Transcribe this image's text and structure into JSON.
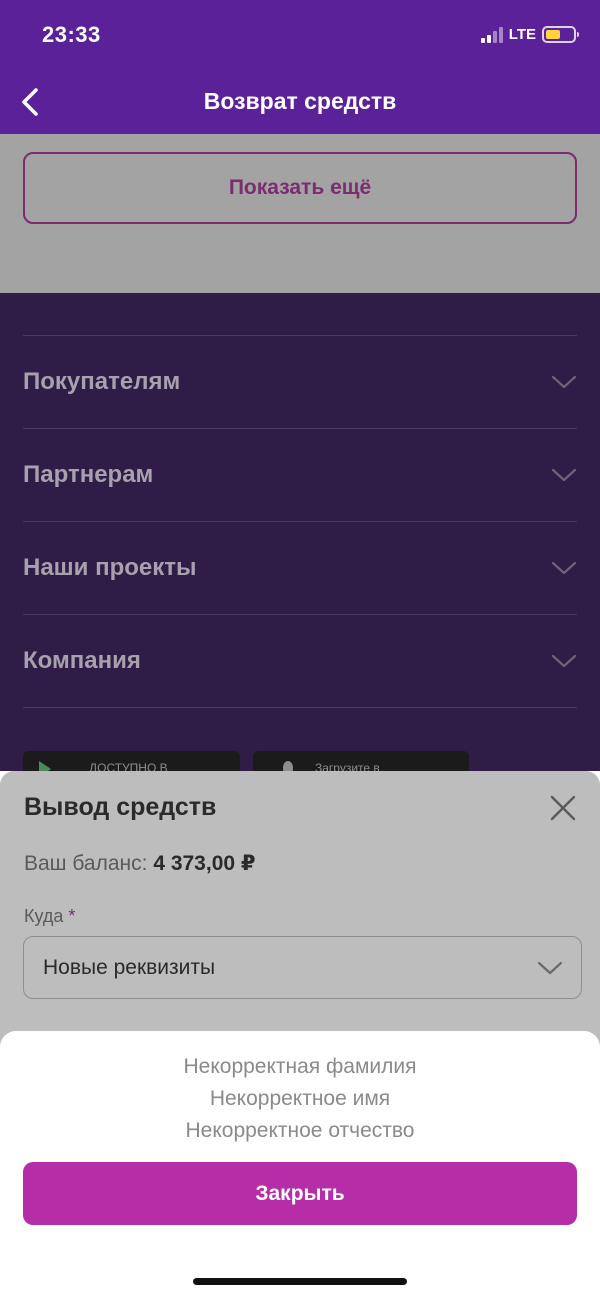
{
  "status": {
    "time": "23:33",
    "network": "LTE",
    "battery_level": 0.55,
    "battery_color": "#ffd23f"
  },
  "header": {
    "title": "Возврат средств",
    "bg_color": "#5b2199"
  },
  "page": {
    "show_more_label": "Показать ещё",
    "footer_items": [
      {
        "label": "Покупателям"
      },
      {
        "label": "Партнерам"
      },
      {
        "label": "Наши проекты"
      },
      {
        "label": "Компания"
      }
    ],
    "store_badges": [
      {
        "name": "google-play",
        "label": "ДОСТУПНО В"
      },
      {
        "name": "app-store",
        "label": "Загрузите в"
      }
    ]
  },
  "withdraw": {
    "title": "Вывод средств",
    "balance_label": "Ваш баланс:",
    "balance_value": "4 373,00 ₽",
    "destination_label": "Куда",
    "required_mark": "*",
    "destination_value": "Новые реквизиты"
  },
  "toast": {
    "messages": [
      "Некорректная фамилия",
      "Некорректное имя",
      "Некорректное отчество"
    ],
    "close_label": "Закрыть",
    "accent_color": "#b62ea7"
  }
}
